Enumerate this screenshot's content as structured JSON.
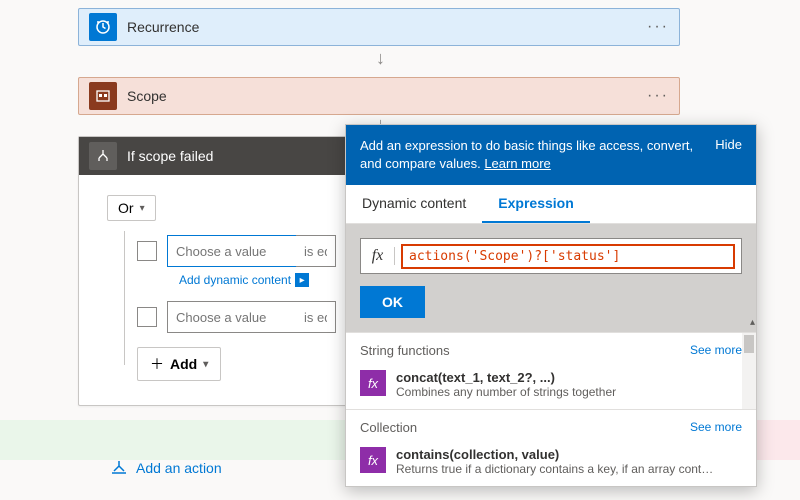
{
  "steps": {
    "recurrence": {
      "title": "Recurrence"
    },
    "scope": {
      "title": "Scope"
    },
    "condition": {
      "title": "If scope failed"
    }
  },
  "condition": {
    "group_op": "Or",
    "row1": {
      "value_placeholder": "Choose a value",
      "op_placeholder": "is eq"
    },
    "row2": {
      "value_placeholder": "Choose a value",
      "op_placeholder": "is eq"
    },
    "dynamic_link": "Add dynamic content",
    "add_label": "Add"
  },
  "add_action": "Add an action",
  "popover": {
    "message": "Add an expression to do basic things like access, convert, and compare values.",
    "learn": "Learn more",
    "hide": "Hide",
    "tabs": {
      "dynamic": "Dynamic content",
      "expression": "Expression"
    },
    "fx_label": "fx",
    "expression_value": "actions('Scope')?['status']",
    "ok": "OK",
    "sections": [
      {
        "title": "String functions",
        "see_more": "See more",
        "item": {
          "sig": "concat(text_1, text_2?, ...)",
          "desc": "Combines any number of strings together"
        }
      },
      {
        "title": "Collection",
        "see_more": "See more",
        "item": {
          "sig": "contains(collection, value)",
          "desc": "Returns true if a dictionary contains a key, if an array cont…"
        }
      }
    ]
  }
}
